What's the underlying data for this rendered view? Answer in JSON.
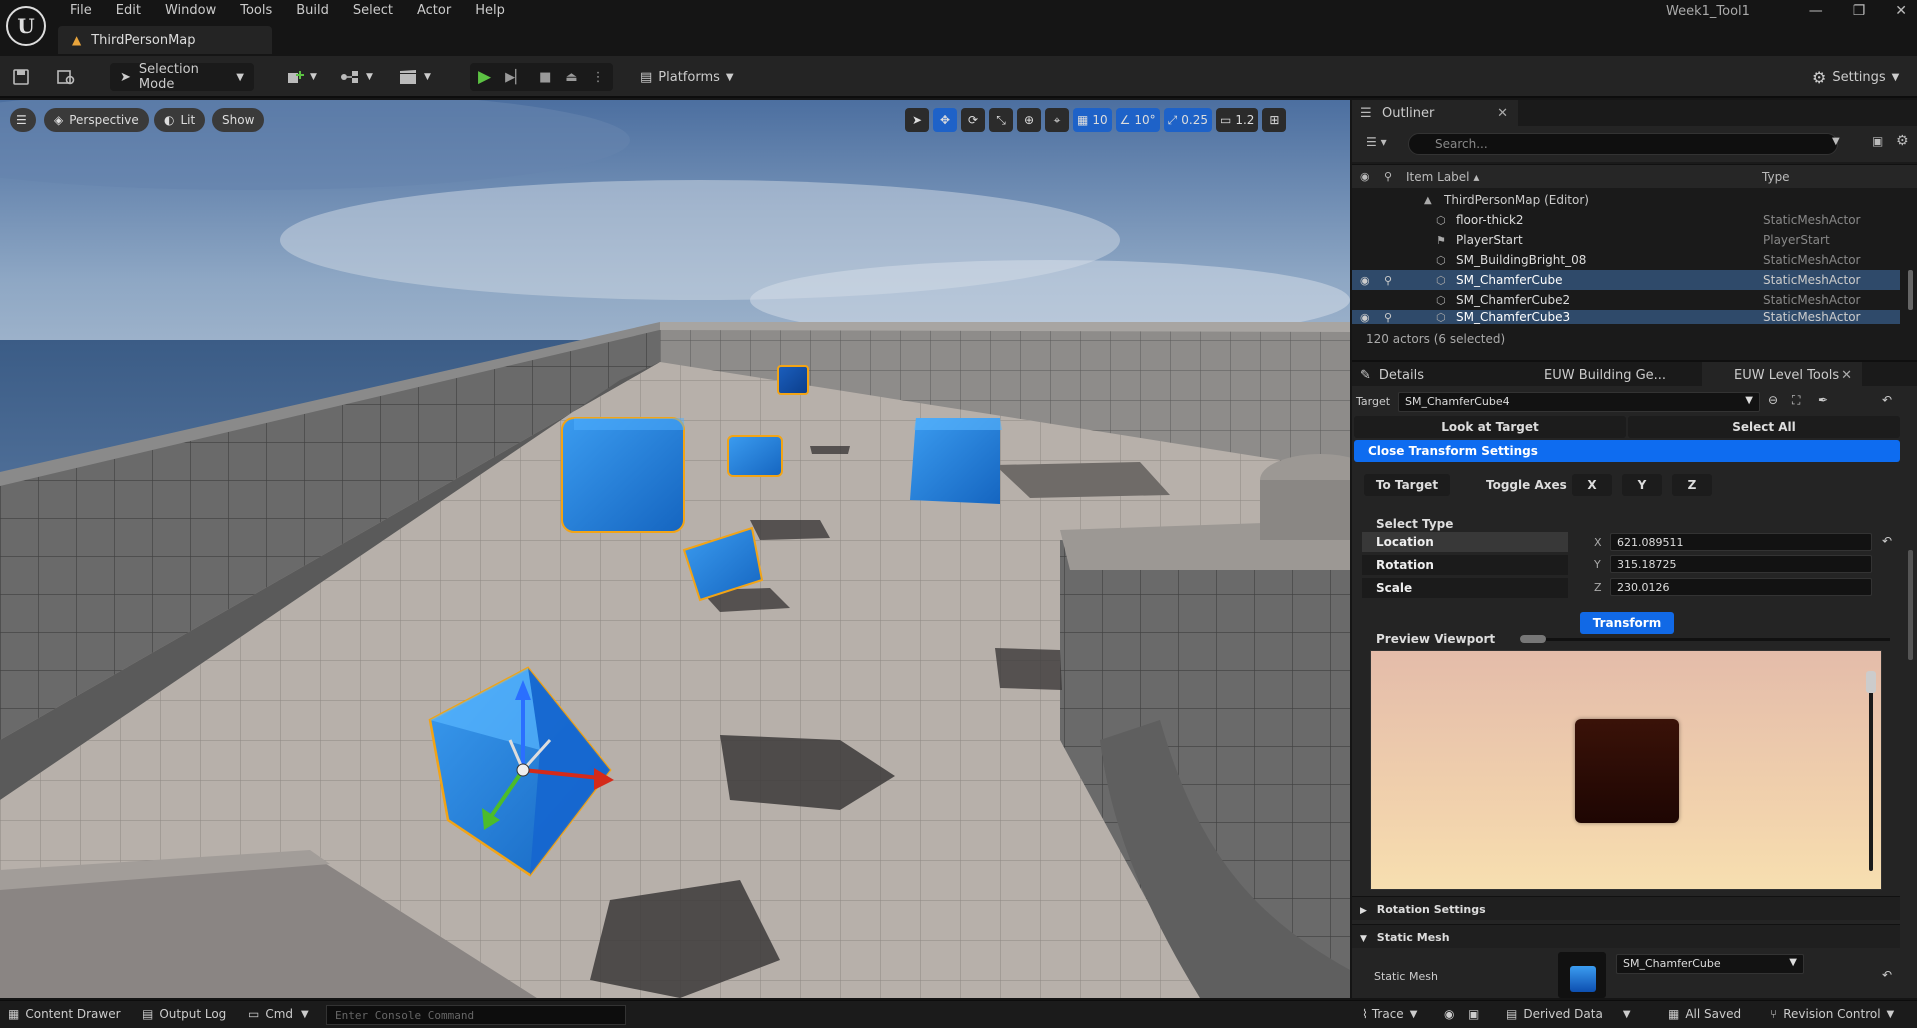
{
  "app": {
    "logo_text": "U",
    "project_title": "Week1_Tool1",
    "map_tab": "ThirdPersonMap",
    "win_controls": [
      "—",
      "❐",
      "✕"
    ]
  },
  "menu": [
    "File",
    "Edit",
    "Window",
    "Tools",
    "Build",
    "Select",
    "Actor",
    "Help"
  ],
  "toolbar": {
    "selection_mode": "Selection Mode",
    "platforms": "Platforms",
    "settings": "Settings"
  },
  "viewport": {
    "perspective": "Perspective",
    "lit": "Lit",
    "show": "Show",
    "grid_snap": "10",
    "rot_snap": "10°",
    "scale_snap": "0.25",
    "cam_speed": "1.2"
  },
  "outliner": {
    "tab": "Outliner",
    "search_placeholder": "Search...",
    "col_label": "Item Label ▴",
    "col_type": "Type",
    "root": "ThirdPersonMap (Editor)",
    "rows": [
      {
        "label": "floor-thick2",
        "type": "StaticMeshActor"
      },
      {
        "label": "PlayerStart",
        "type": "PlayerStart"
      },
      {
        "label": "SM_BuildingBright_08",
        "type": "StaticMeshActor"
      },
      {
        "label": "SM_ChamferCube",
        "type": "StaticMeshActor"
      },
      {
        "label": "SM_ChamferCube2",
        "type": "StaticMeshActor"
      },
      {
        "label": "SM_ChamferCube3",
        "type": "StaticMeshActor"
      }
    ],
    "count": "120 actors (6 selected)"
  },
  "details": {
    "tabs": [
      "Details",
      "EUW Building Ge...",
      "EUW Level Tools"
    ],
    "target_label": "Target",
    "target_value": "SM_ChamferCube4",
    "look_at": "Look at Target",
    "select_all": "Select All",
    "close_transform": "Close Transform Settings",
    "to_target": "To Target",
    "toggle_axes": "Toggle Axes",
    "axes": [
      "X",
      "Y",
      "Z"
    ],
    "select_type": "Select Type",
    "types": [
      "Location",
      "Rotation",
      "Scale"
    ],
    "values": [
      "621.089511",
      "315.18725",
      "230.0126"
    ],
    "transform": "Transform",
    "preview": "Preview Viewport",
    "rotation_settings": "Rotation Settings",
    "static_mesh_section": "Static Mesh",
    "static_mesh_label": "Static Mesh",
    "static_mesh_value": "SM_ChamferCube"
  },
  "status": {
    "content_drawer": "Content Drawer",
    "output_log": "Output Log",
    "cmd": "Cmd",
    "console_placeholder": "Enter Console Command",
    "trace": "Trace",
    "derived_data": "Derived Data",
    "all_saved": "All Saved",
    "revision_control": "Revision Control"
  },
  "colors": {
    "accent_blue": "#1e62c8",
    "play_green": "#5cc243",
    "selection_orange": "#f2a416"
  }
}
